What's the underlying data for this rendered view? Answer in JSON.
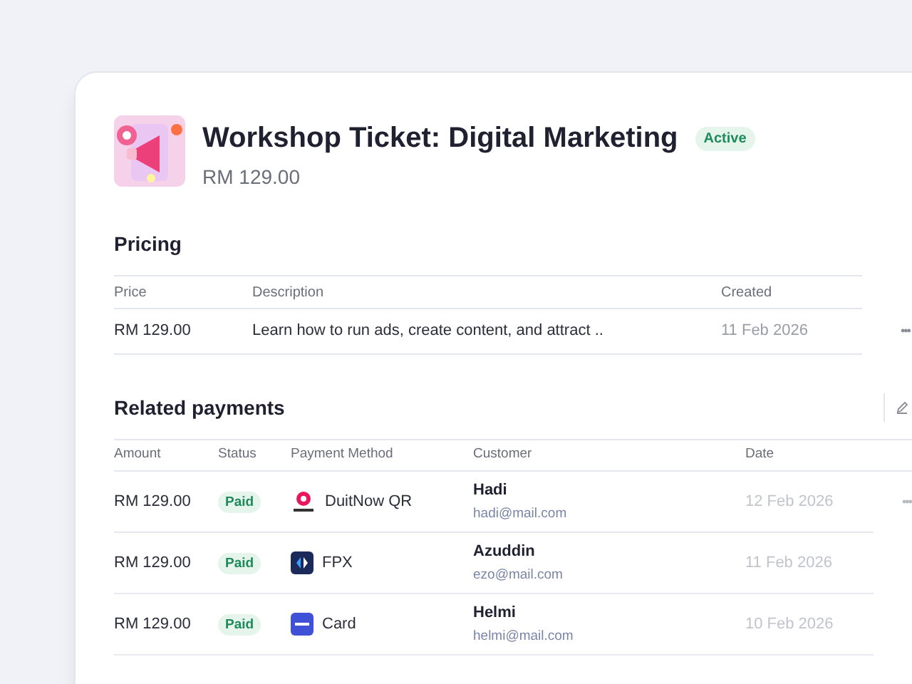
{
  "product": {
    "title": "Workshop Ticket: Digital Marketing",
    "status": "Active",
    "price": "RM 129.00"
  },
  "pricing": {
    "heading": "Pricing",
    "columns": [
      "Price",
      "Description",
      "Created"
    ],
    "rows": [
      {
        "price": "RM 129.00",
        "description": "Learn how to run ads, create content, and attract ..",
        "created": "11 Feb 2026",
        "menu": "•••"
      }
    ]
  },
  "payments": {
    "heading": "Related payments",
    "columns": [
      "Amount",
      "Status",
      "Payment Method",
      "Customer",
      "Date"
    ],
    "rows": [
      {
        "amount": "RM 129.00",
        "status": "Paid",
        "method": {
          "kind": "duitnow",
          "label": "DuitNow QR"
        },
        "customer": "Hadi",
        "email": "hadi@mail.com",
        "date": "12 Feb 2026",
        "menu": "•••"
      },
      {
        "amount": "RM 129.00",
        "status": "Paid",
        "method": {
          "kind": "fpx",
          "label": "FPX"
        },
        "customer": "Azuddin",
        "email": "ezo@mail.com",
        "date": "11 Feb 2026"
      },
      {
        "amount": "RM 129.00",
        "status": "Paid",
        "method": {
          "kind": "card",
          "label": "Card"
        },
        "customer": "Helmi",
        "email": "helmi@mail.com",
        "date": "10 Feb 2026"
      }
    ]
  }
}
